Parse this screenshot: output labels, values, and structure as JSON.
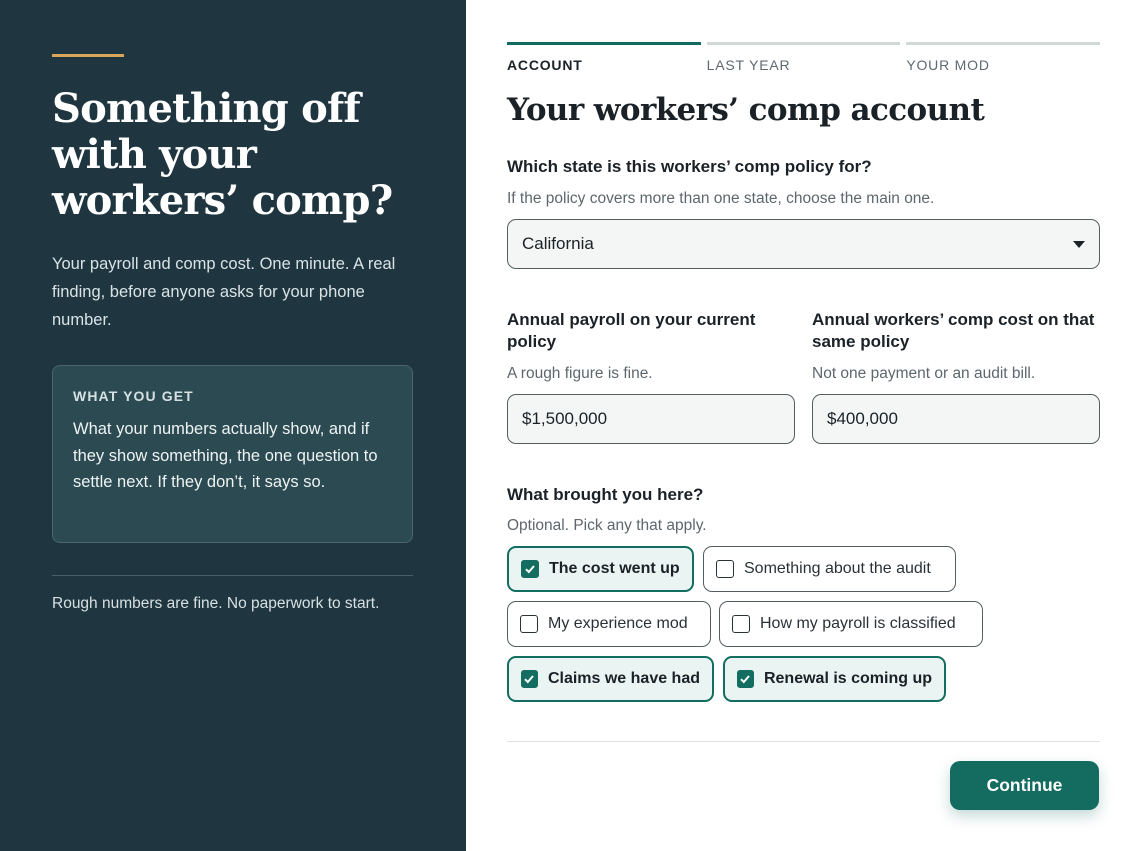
{
  "left": {
    "title": "Something off with your workers’ comp?",
    "subtitle": "Your payroll and comp cost. One minute. A real finding, before anyone asks for your phone number.",
    "card_label": "WHAT YOU GET",
    "card_text": "What your numbers actually show, and if they show something, the one question to settle next. If they don’t, it says so.",
    "footer": "Rough numbers are fine. No paperwork to start."
  },
  "steps": [
    {
      "label": "ACCOUNT",
      "active": true
    },
    {
      "label": "LAST YEAR",
      "active": false
    },
    {
      "label": "YOUR MOD",
      "active": false
    }
  ],
  "form": {
    "title": "Your workers’ comp account",
    "state": {
      "label": "Which state is this workers’ comp policy for?",
      "help": "If the policy covers more than one state, choose the main one.",
      "value": "California"
    },
    "payroll": {
      "label": "Annual payroll on your current policy",
      "help": "A rough figure is fine.",
      "value": "$1,500,000"
    },
    "comp_cost": {
      "label": "Annual workers’ comp cost on that same policy",
      "help": "Not one payment or an audit bill.",
      "value": "$400,000"
    },
    "reasons": {
      "label": "What brought you here?",
      "help": "Optional. Pick any that apply.",
      "options": [
        {
          "label": "The cost went up",
          "checked": true
        },
        {
          "label": "Something about the audit",
          "checked": false
        },
        {
          "label": "My experience mod",
          "checked": false
        },
        {
          "label": "How my payroll is classified",
          "checked": false
        },
        {
          "label": "Claims we have had",
          "checked": true
        },
        {
          "label": "Renewal is coming up",
          "checked": true
        }
      ]
    },
    "continue_label": "Continue"
  },
  "colors": {
    "left_panel": "#1f3640",
    "accent": "#d9a55a",
    "primary": "#146b5f"
  }
}
